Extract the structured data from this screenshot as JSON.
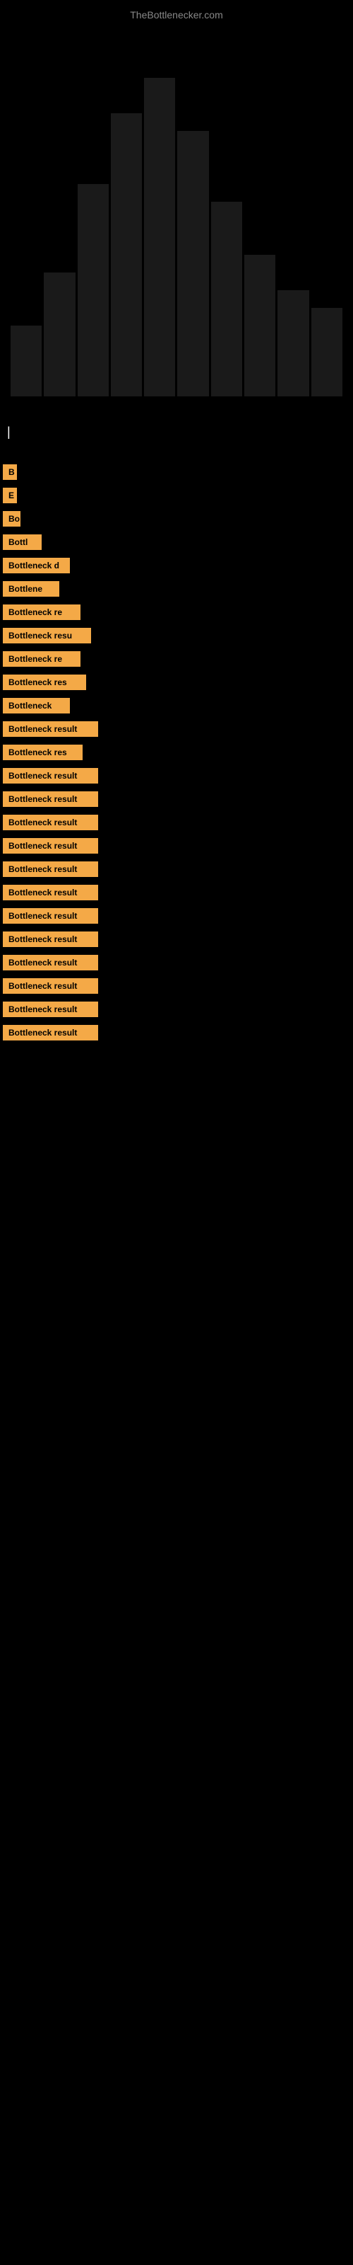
{
  "site": {
    "title": "TheBottlenecker.com"
  },
  "colors": {
    "accent": "#F4A947",
    "background": "#000000",
    "text_dark": "#000000"
  },
  "bottleneck_items": [
    {
      "id": 1,
      "label": "B",
      "width_class": "w-20"
    },
    {
      "id": 2,
      "label": "E",
      "width_class": "w-20"
    },
    {
      "id": 3,
      "label": "Bo",
      "width_class": "w-25"
    },
    {
      "id": 4,
      "label": "Bottl",
      "width_class": "w-55"
    },
    {
      "id": 5,
      "label": "Bottleneck d",
      "width_class": "w-90"
    },
    {
      "id": 6,
      "label": "Bottlene",
      "width_class": "w-80"
    },
    {
      "id": 7,
      "label": "Bottleneck re",
      "width_class": "w-110"
    },
    {
      "id": 8,
      "label": "Bottleneck resu",
      "width_class": "w-120"
    },
    {
      "id": 9,
      "label": "Bottleneck re",
      "width_class": "w-110"
    },
    {
      "id": 10,
      "label": "Bottleneck res",
      "width_class": "w-115"
    },
    {
      "id": 11,
      "label": "Bottleneck",
      "width_class": "w-100"
    },
    {
      "id": 12,
      "label": "Bottleneck result",
      "width_class": "w-130"
    },
    {
      "id": 13,
      "label": "Bottleneck res",
      "width_class": "w-115"
    },
    {
      "id": 14,
      "label": "Bottleneck result",
      "width_class": "w-130"
    },
    {
      "id": 15,
      "label": "Bottleneck result",
      "width_class": "w-130"
    },
    {
      "id": 16,
      "label": "Bottleneck result",
      "width_class": "w-130"
    },
    {
      "id": 17,
      "label": "Bottleneck result",
      "width_class": "w-130"
    },
    {
      "id": 18,
      "label": "Bottleneck result",
      "width_class": "w-130"
    },
    {
      "id": 19,
      "label": "Bottleneck result",
      "width_class": "w-130"
    },
    {
      "id": 20,
      "label": "Bottleneck result",
      "width_class": "w-130"
    },
    {
      "id": 21,
      "label": "Bottleneck result",
      "width_class": "w-130"
    },
    {
      "id": 22,
      "label": "Bottleneck result",
      "width_class": "w-130"
    },
    {
      "id": 23,
      "label": "Bottleneck result",
      "width_class": "w-130"
    },
    {
      "id": 24,
      "label": "Bottleneck result",
      "width_class": "w-130"
    },
    {
      "id": 25,
      "label": "Bottleneck result",
      "width_class": "w-130"
    }
  ]
}
